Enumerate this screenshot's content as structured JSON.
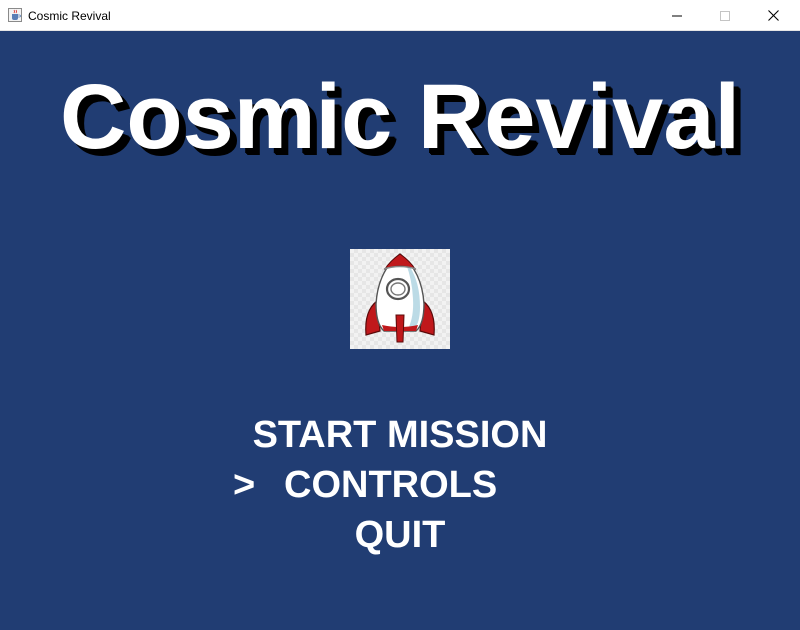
{
  "window": {
    "title": "Cosmic Revival",
    "icons": {
      "app": "java-cup-icon",
      "minimize": "minimize-icon",
      "maximize": "maximize-icon",
      "close": "close-icon"
    }
  },
  "game": {
    "title": "Cosmic Revival",
    "logo": "rocket-icon",
    "background_color": "#213d73",
    "menu": {
      "items": [
        "START MISSION",
        "CONTROLS",
        "QUIT"
      ],
      "selected_index": 1,
      "cursor": ">"
    }
  }
}
